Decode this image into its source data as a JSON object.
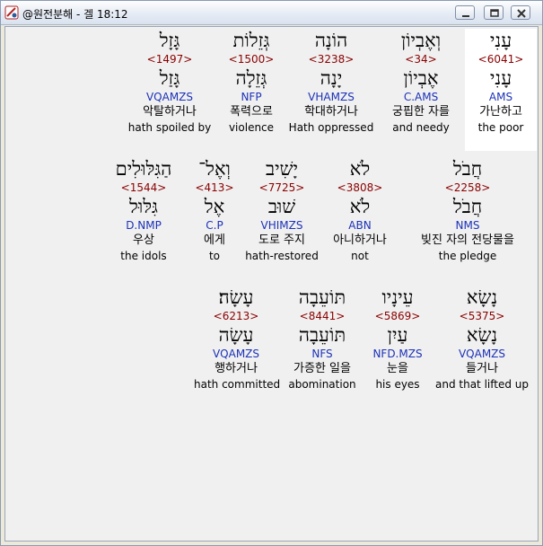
{
  "window": {
    "title": "@원전분해 - 겔 18:12"
  },
  "rows": [
    [
      {
        "heb": "עָנִי",
        "num": "<6041>",
        "lemma": "עָנִי",
        "code": "AMS",
        "kor": "가난하고",
        "eng": "the poor",
        "selected": true
      },
      {
        "heb": "וְאֶבְיוֹן",
        "num": "<34>",
        "lemma": "אֶבְיוֹן",
        "code": "C.AMS",
        "kor": "궁핍한 자를",
        "eng": "and needy"
      },
      {
        "heb": "הוֹנָה",
        "num": "<3238>",
        "lemma": "יָנָה",
        "code": "VHAMZS",
        "kor": "학대하거나",
        "eng": "Hath oppressed"
      },
      {
        "heb": "גְּזֵלוֹת",
        "num": "<1500>",
        "lemma": "גְּזֵלָה",
        "code": "NFP",
        "kor": "폭력으로",
        "eng": "violence"
      },
      {
        "heb": "גָּזָל",
        "num": "<1497>",
        "lemma": "גָּזַל",
        "code": "VQAMZS",
        "kor": "악탈하거나",
        "eng": "hath spoiled  by"
      }
    ],
    [
      {
        "heb": "חֲבֹל",
        "num": "<2258>",
        "lemma": "חֲבֹל",
        "code": "NMS",
        "kor": "빚진 자의 전당물을",
        "eng": "the pledge"
      },
      {
        "heb": "לֹא",
        "num": "<3808>",
        "lemma": "לֹא",
        "code": "ABN",
        "kor": "아니하거나",
        "eng": "not"
      },
      {
        "heb": "יָשִׁיב",
        "num": "<7725>",
        "lemma": "שׁוּב",
        "code": "VHIMZS",
        "kor": "도로 주지",
        "eng": "hath-restored"
      },
      {
        "heb": "וְאֶל־",
        "num": "<413>",
        "lemma": "אֶל",
        "code": "C.P",
        "kor": "에게",
        "eng": "to"
      },
      {
        "heb": "הַגִּלּוּלִים",
        "num": "<1544>",
        "lemma": "גִּלּוּל",
        "code": "D.NMP",
        "kor": "우상",
        "eng": "the idols"
      }
    ],
    [
      {
        "heb": "נָשָׂא",
        "num": "<5375>",
        "lemma": "נָשָׂא",
        "code": "VQAMZS",
        "kor": "들거나",
        "eng": "and that lifted up"
      },
      {
        "heb": "עֵינָיו",
        "num": "<5869>",
        "lemma": "עַיִן",
        "code": "NFD.MZS",
        "kor": "눈을",
        "eng": "his eyes"
      },
      {
        "heb": "תּוֹעֵבָה",
        "num": "<8441>",
        "lemma": "תּוֹעֵבָה",
        "code": "NFS",
        "kor": "가증한 일을",
        "eng": "abomination"
      },
      {
        "heb": "עָשָׂה׃",
        "num": "<6213>",
        "lemma": "עָשָׂה",
        "code": "VQAMZS",
        "kor": "행하거나",
        "eng": "hath committed"
      }
    ]
  ]
}
